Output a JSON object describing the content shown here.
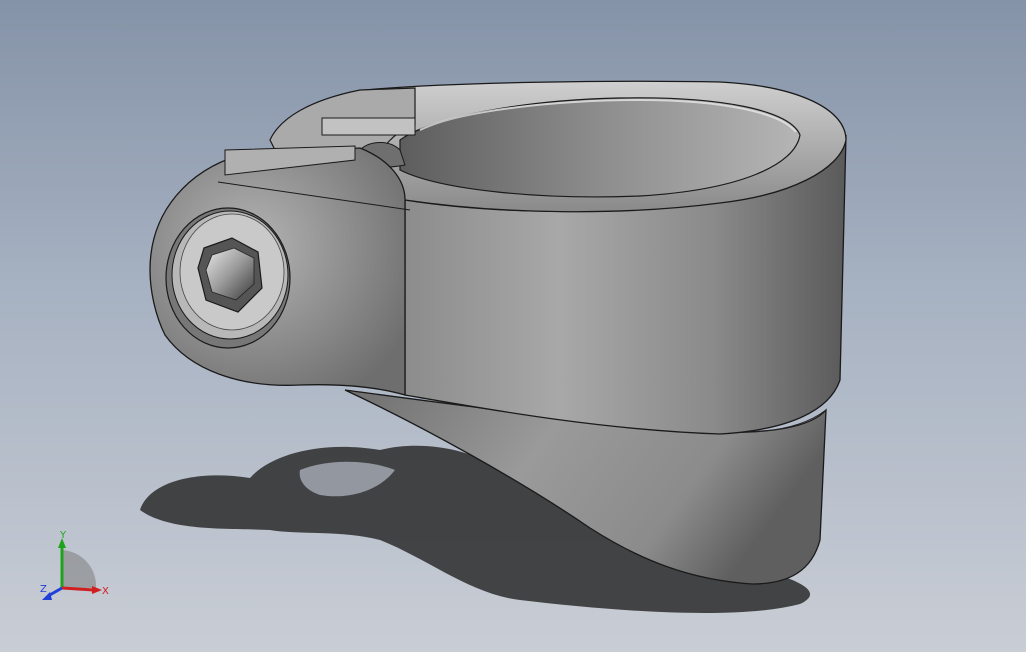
{
  "viewport": {
    "background_top": "#8593a8",
    "background_bottom": "#c9cdd5"
  },
  "model": {
    "type": "seatpost clamp",
    "body_color": "#9c9c9c",
    "edge_color": "#1a1a1a",
    "bolt_icon": "hex-socket-bolt-icon"
  },
  "triad": {
    "x_label": "X",
    "y_label": "Y",
    "z_label": "Z",
    "x_color": "#d11f1f",
    "y_color": "#1fa31f",
    "z_color": "#1f3fd6"
  }
}
